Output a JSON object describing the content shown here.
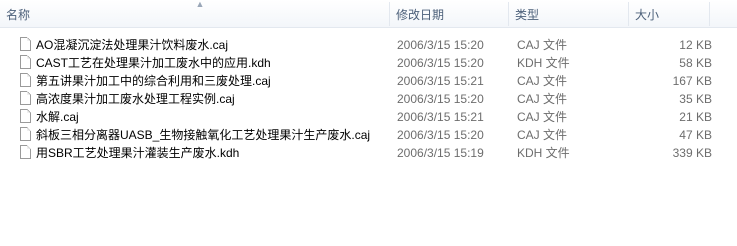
{
  "columns": {
    "name": "名称",
    "modified": "修改日期",
    "type": "类型",
    "size": "大小"
  },
  "sort_indicator": "up-arrow",
  "files": [
    {
      "name": "AO混凝沉淀法处理果汁饮料废水.caj",
      "modified": "2006/3/15 15:20",
      "type": "CAJ 文件",
      "size": "12 KB",
      "icon": "document-icon"
    },
    {
      "name": "CAST工艺在处理果汁加工废水中的应用.kdh",
      "modified": "2006/3/15 15:20",
      "type": "KDH 文件",
      "size": "58 KB",
      "icon": "document-icon"
    },
    {
      "name": "第五讲果汁加工中的综合利用和三废处理.caj",
      "modified": "2006/3/15 15:21",
      "type": "CAJ 文件",
      "size": "167 KB",
      "icon": "document-icon"
    },
    {
      "name": "高浓度果汁加工废水处理工程实例.caj",
      "modified": "2006/3/15 15:20",
      "type": "CAJ 文件",
      "size": "35 KB",
      "icon": "document-icon"
    },
    {
      "name": "水解.caj",
      "modified": "2006/3/15 15:21",
      "type": "CAJ 文件",
      "size": "21 KB",
      "icon": "document-icon"
    },
    {
      "name": "斜板三相分离器UASB_生物接触氧化工艺处理果汁生产废水.caj",
      "modified": "2006/3/15 15:20",
      "type": "CAJ 文件",
      "size": "47 KB",
      "icon": "document-icon"
    },
    {
      "name": "用SBR工艺处理果汁灌装生产废水.kdh",
      "modified": "2006/3/15 15:19",
      "type": "KDH 文件",
      "size": "339 KB",
      "icon": "document-icon"
    }
  ]
}
